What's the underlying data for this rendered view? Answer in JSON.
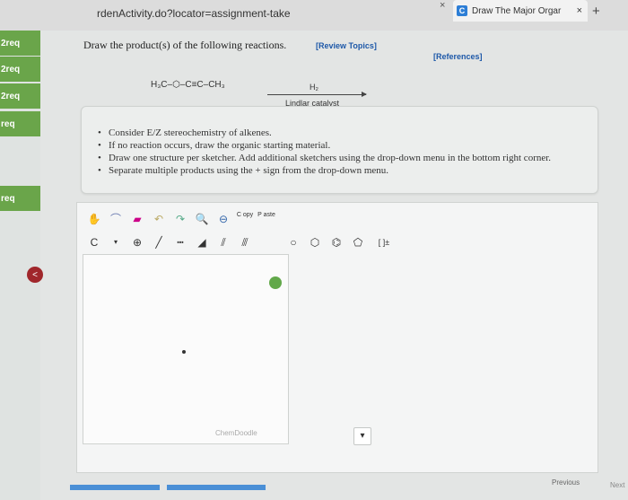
{
  "browser": {
    "url": "rdenActivity.do?locator=assignment-take",
    "tab_close_left": "×",
    "tab_title": "Draw The Major Orgar",
    "tab_favicon": "C",
    "tab_close": "×",
    "new_tab": "+"
  },
  "sidebar": {
    "items": [
      {
        "label": "2req"
      },
      {
        "label": "2req"
      },
      {
        "label": "2req"
      },
      {
        "label": "req"
      },
      {
        "label": "req"
      }
    ],
    "badge": "<"
  },
  "question": {
    "title": "Draw the product(s) of the following reactions.",
    "review_link": "[Review Topics]",
    "references_link": "[References]",
    "reactant": "H₃C–⬡–C≡C–CH₃",
    "reagent_top": "H₂",
    "reagent_bottom": "Lindlar catalyst",
    "instructions": [
      "Consider E/Z stereochemistry of alkenes.",
      "If no reaction occurs, draw the organic starting material.",
      "Draw one structure per sketcher. Add additional sketchers using the drop-down menu in the bottom right corner.",
      "Separate multiple products using the + sign from the drop-down menu."
    ]
  },
  "sketcher": {
    "tool_copy": "C opy",
    "tool_paste": "P aste",
    "tool_c": "C",
    "tool_plus": "⊕",
    "watermark": "ChemDoodle",
    "charge": "[ ]±"
  },
  "nav": {
    "previous": "Previous",
    "next": "Next"
  }
}
